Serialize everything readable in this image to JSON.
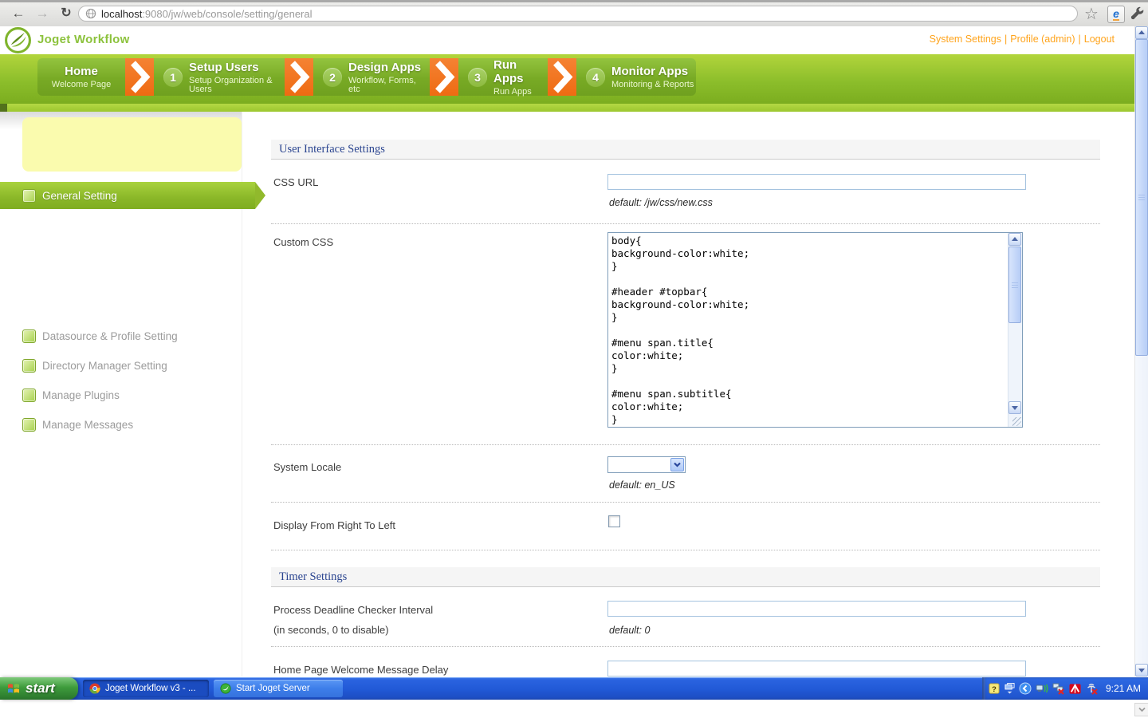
{
  "browser": {
    "url": {
      "host": "localhost",
      "rest": ":9080/jw/web/console/setting/general"
    },
    "icons": {
      "back": "←",
      "forward": "→",
      "reload": "↻",
      "star": "☆",
      "ie_ext": "e"
    }
  },
  "header": {
    "logo_text": "Joget Workflow",
    "separator": "|",
    "links": [
      {
        "label": "System Settings"
      },
      {
        "label": "Profile (admin)"
      },
      {
        "label": "Logout"
      }
    ]
  },
  "nav": {
    "tabs": [
      {
        "number": "",
        "title": "Home",
        "subtitle": "Welcome Page"
      },
      {
        "number": "1",
        "title": "Setup Users",
        "subtitle": "Setup Organization & Users"
      },
      {
        "number": "2",
        "title": "Design Apps",
        "subtitle": "Workflow, Forms, etc"
      },
      {
        "number": "3",
        "title": "Run Apps",
        "subtitle": "Run Apps"
      },
      {
        "number": "4",
        "title": "Monitor Apps",
        "subtitle": "Monitoring & Reports"
      }
    ]
  },
  "sidebar": {
    "items": [
      {
        "label": "General Setting",
        "active": true
      },
      {
        "label": "Datasource & Profile Setting",
        "active": false
      },
      {
        "label": "Directory Manager Setting",
        "active": false
      },
      {
        "label": "Manage Plugins",
        "active": false
      },
      {
        "label": "Manage Messages",
        "active": false
      }
    ]
  },
  "main": {
    "sections": {
      "ui": {
        "title": "User Interface Settings"
      },
      "timer": {
        "title": "Timer Settings"
      }
    },
    "fields": {
      "css_url": {
        "label": "CSS URL",
        "value": "",
        "hint": "default: /jw/css/new.css"
      },
      "custom_css": {
        "label": "Custom CSS",
        "value": "body{\nbackground-color:white;\n}\n\n#header #topbar{\nbackground-color:white;\n}\n\n#menu span.title{\ncolor:white;\n}\n\n#menu span.subtitle{\ncolor:white;\n}"
      },
      "system_locale": {
        "label": "System Locale",
        "value": "",
        "hint": "default: en_US"
      },
      "rtl": {
        "label": "Display From Right To Left",
        "checked": false
      },
      "deadline_interval": {
        "label": "Process Deadline Checker Interval",
        "sublabel": "(in seconds, 0 to disable)",
        "value": "",
        "hint": "default: 0"
      },
      "welcome_delay": {
        "label": "Home Page Welcome Message Delay",
        "value": ""
      }
    }
  },
  "taskbar": {
    "start_label": "start",
    "tasks": [
      {
        "label": "Joget Workflow v3 - ...",
        "active": true
      },
      {
        "label": "Start Joget Server",
        "active": false
      }
    ],
    "time": "9:21 AM"
  },
  "colors": {
    "joget_green": "#8DC63F",
    "nav_orange": "#F0721C",
    "link_orange": "#FFA41C",
    "section_header_blue": "#2B4590",
    "taskbar_blue": "#2159D6",
    "sidebar_highlight_yellow": "#FAFBAE"
  }
}
